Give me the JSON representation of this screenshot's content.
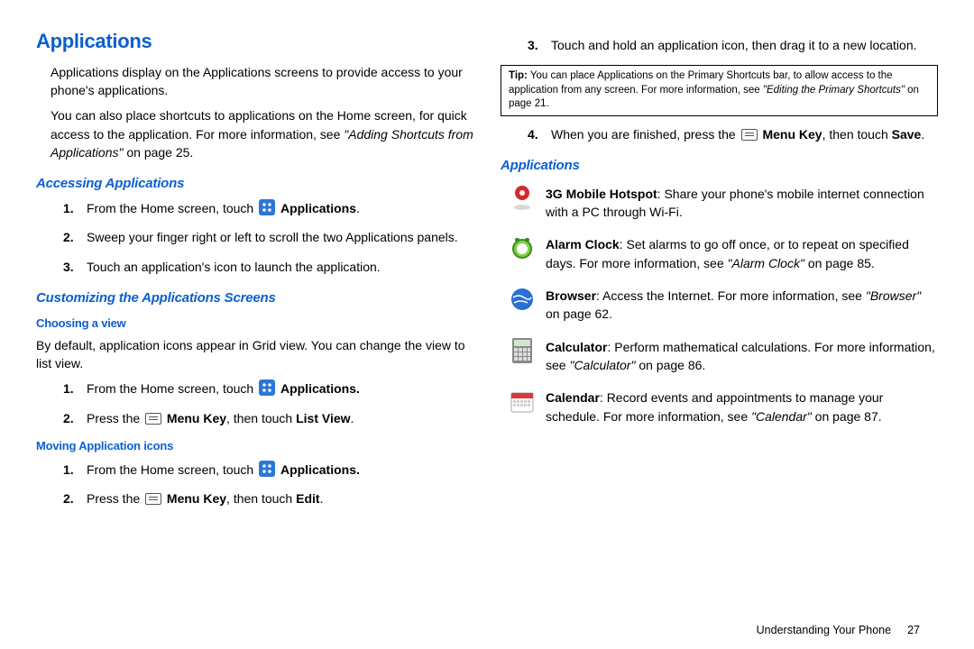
{
  "left": {
    "title": "Applications",
    "intro1": "Applications display on the Applications screens to provide access to your phone's applications.",
    "intro2a": "You can also place shortcuts to applications on the Home screen, for quick access to the application. For more information, see ",
    "intro2b": "\"Adding Shortcuts from Applications\"",
    "intro2c": " on page 25.",
    "accessing_h": "Accessing Applications",
    "acc1a": "From the Home screen, touch ",
    "acc1b": "Applications",
    "acc1c": ".",
    "acc2": "Sweep your finger right or left to scroll the two Applications panels.",
    "acc3": "Touch an application's icon to launch the application.",
    "custom_h": "Customizing the Applications Screens",
    "choose_h": "Choosing a view",
    "choose_p": "By default, application icons appear in Grid view. You can change the view to list view.",
    "ch1a": "From the Home screen, touch ",
    "ch1b": "Applications.",
    "ch2a": "Press the ",
    "ch2b": "Menu Key",
    "ch2c": ", then touch ",
    "ch2d": "List View",
    "ch2e": ".",
    "move_h": "Moving Application icons",
    "mv1a": "From the Home screen, touch ",
    "mv1b": "Applications.",
    "mv2a": "Press the ",
    "mv2b": "Menu Key",
    "mv2c": ", then touch ",
    "mv2d": "Edit",
    "mv2e": "."
  },
  "right": {
    "r3": "Touch and hold an application icon, then drag it to a new location.",
    "tip_label": "Tip:",
    "tip_a": " You can place Applications on the Primary Shortcuts bar, to allow access to the application from any screen. For more information, see ",
    "tip_b": "\"Editing the Primary Shortcuts\"",
    "tip_c": " on page 21.",
    "r4a": "When you are finished, press the ",
    "r4b": "Menu Key",
    "r4c": ", then touch ",
    "r4d": "Save",
    "r4e": ".",
    "apps_h": "Applications",
    "hotspot_name": "3G Mobile Hotspot",
    "hotspot_text": ": Share your phone's mobile internet connection with a PC through Wi-Fi.",
    "alarm_name": "Alarm Clock",
    "alarm_a": ": Set alarms to go off once, or to repeat on specified days. For more information, see ",
    "alarm_b": "\"Alarm Clock\"",
    "alarm_c": " on page 85.",
    "browser_name": "Browser",
    "browser_a": ": Access the Internet. For more information, see ",
    "browser_b": "\"Browser\"",
    "browser_c": " on page 62.",
    "calc_name": "Calculator",
    "calc_a": ": Perform mathematical calculations. For more information, see ",
    "calc_b": "\"Calculator\"",
    "calc_c": " on page 86.",
    "cal_name": "Calendar",
    "cal_a": ": Record events and appointments to manage your schedule. For more information, see ",
    "cal_b": "\"Calendar\"",
    "cal_c": " on page 87."
  },
  "footer": {
    "section": "Understanding Your Phone",
    "page": "27"
  }
}
